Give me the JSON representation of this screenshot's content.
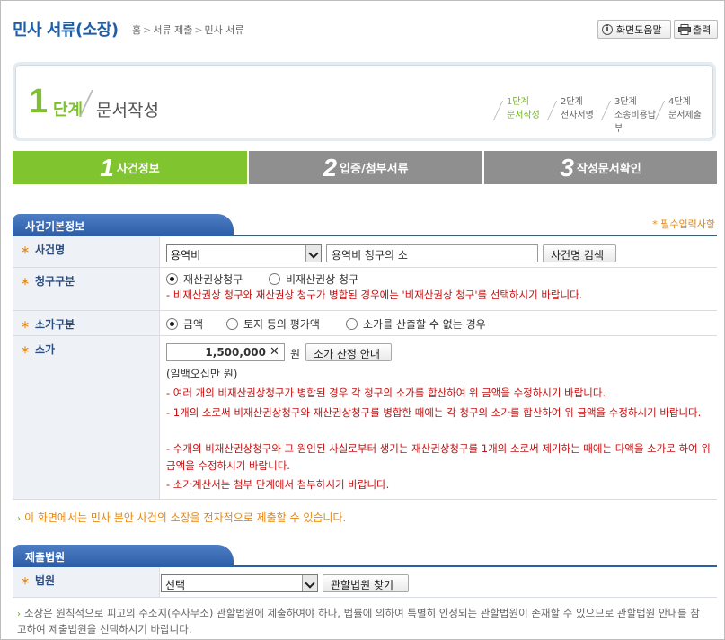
{
  "header": {
    "title": "민사 서류(소장)",
    "breadcrumb": [
      "홈",
      "서류 제출",
      "민사 서류"
    ],
    "help_label": "화면도움말",
    "print_label": "출력"
  },
  "stepbox": {
    "num": "1",
    "unit": "단계",
    "name": "문서작성",
    "steps": [
      {
        "step": "1단계",
        "label": "문서작성",
        "active": true
      },
      {
        "step": "2단계",
        "label": "전자서명",
        "active": false
      },
      {
        "step": "3단계",
        "label": "소송비용납부",
        "active": false
      },
      {
        "step": "4단계",
        "label": "문서제출",
        "active": false
      }
    ]
  },
  "tabs": [
    {
      "num": "1",
      "label": "사건정보",
      "active": true
    },
    {
      "num": "2",
      "label": "입증/첨부서류",
      "active": false
    },
    {
      "num": "3",
      "label": "작성문서확인",
      "active": false
    }
  ],
  "basic": {
    "section_title": "사건기본정보",
    "required_note": "* 필수입력사항",
    "case_name": {
      "label": "사건명",
      "select_value": "용역비",
      "input_value": "용역비 청구의 소",
      "search_button": "사건명 검색"
    },
    "claim_type": {
      "label": "청구구분",
      "options": [
        "재산권상청구",
        "비재산권상 청구"
      ],
      "selected": 0,
      "warning": "- 비재산권상 청구와 재산권상 청구가 병합된 경우에는 '비재산권상 청구'를 선택하시기 바랍니다."
    },
    "value_type": {
      "label": "소가구분",
      "options": [
        "금액",
        "토지 등의 평가액",
        "소가를 산출할 수 없는 경우"
      ],
      "selected": 0
    },
    "value": {
      "label": "소가",
      "amount": "1,500,000",
      "unit": "원",
      "guide_button": "소가 산정 안내",
      "korean_amount": "(일백오십만 원)",
      "warnings": [
        "- 여러 개의 비재산권상청구가 병합된 경우 각 청구의 소가를 합산하여 위 금액을 수정하시기 바랍니다.",
        "- 1개의 소로써 비재산권상청구와 재산권상청구를 병합한 때에는 각 청구의 소가를 합산하여 위 금액을 수정하시기 바랍니다.",
        "- 수개의 비재산권상청구와 그 원인된 사실로부터 생기는 재산권상청구를 1개의 소로써 제기하는 때에는 다액을 소가로 하여 위 금액을 수정하시기 바랍니다.",
        "- 소가계산서는 첨부 단계에서 첨부하시기 바랍니다."
      ]
    },
    "info_note": "이 화면에서는 민사 본안 사건의 소장을 전자적으로 제출할 수 있습니다."
  },
  "court": {
    "section_title": "제출법원",
    "label": "법원",
    "select_value": "선택",
    "find_button": "관할법원 찾기",
    "note": "소장은 원칙적으로 피고의 주소지(주사무소) 관할법원에 제출하여야 하나, 법률에 의하여 특별히 인정되는 관할법원이 존재할 수 있으므로 관할법원 안내를 참고하여 제출법원을 선택하시기 바랍니다."
  }
}
